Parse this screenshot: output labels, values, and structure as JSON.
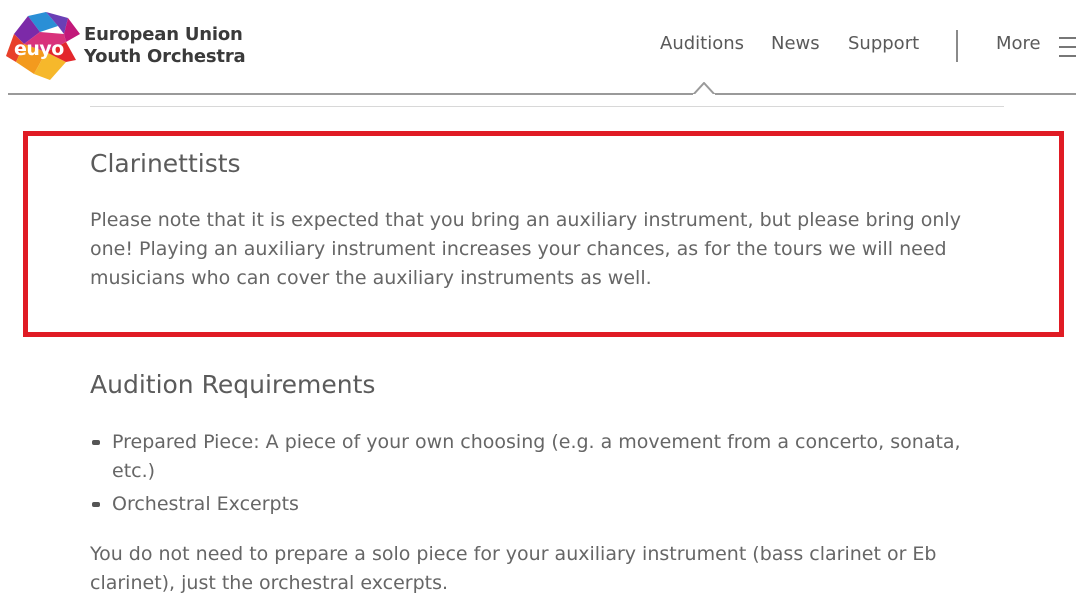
{
  "brand": {
    "logo_text": "euyo",
    "name_line1": "European Union",
    "name_line2": "Youth Orchestra"
  },
  "nav": {
    "items": [
      {
        "label": "Auditions",
        "active": true
      },
      {
        "label": "News",
        "active": false
      },
      {
        "label": "Support",
        "active": false
      }
    ],
    "more_label": "More",
    "menu_icon": "hamburger-menu-icon"
  },
  "clarinettists": {
    "title": "Clarinettists",
    "body": "Please note that it is expected that you bring an auxiliary instrument, but please bring only one! Playing an auxiliary instrument increases your chances, as for the tours we will need musicians who can cover the auxiliary instruments as well."
  },
  "requirements": {
    "title": "Audition Requirements",
    "items": [
      "Prepared Piece: A piece of your own choosing (e.g. a movement from a concerto, sonata, etc.)",
      "Orchestral Excerpts"
    ],
    "note": "You do not need to prepare a solo piece for your auxiliary instrument (bass clarinet or Eb clarinet), just the orchestral excerpts."
  },
  "colors": {
    "highlight_border": "#e01b24",
    "text": "#666666",
    "header_rule": "#9a9a9a"
  }
}
